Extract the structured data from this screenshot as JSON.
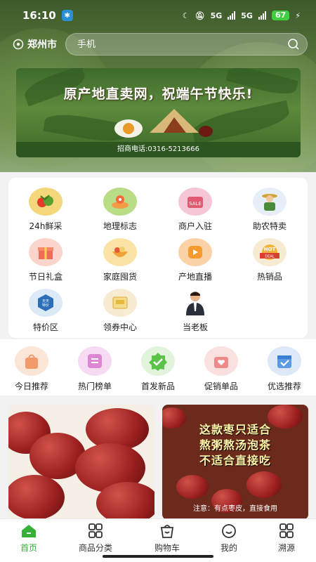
{
  "status": {
    "time": "16:10",
    "battery": "67",
    "network": "5G"
  },
  "topbar": {
    "location": "郑州市",
    "search_placeholder": "手机"
  },
  "banner": {
    "title": "原产地直卖网，祝端午节快乐!",
    "phone": "招商电话:0316-5213666"
  },
  "categories": [
    {
      "label": "24h鲜采",
      "icon": "vegetable-icon",
      "color": "#f3d77a"
    },
    {
      "label": "地理标志",
      "icon": "location-globe-icon",
      "color": "#b9dd87"
    },
    {
      "label": "商户入驻",
      "icon": "shop-sale-icon",
      "color": "#f5c6d6"
    },
    {
      "label": "助农特卖",
      "icon": "farmer-icon",
      "color": "#e6eef8"
    },
    {
      "label": "节日礼盒",
      "icon": "gift-box-icon",
      "color": "#fbd4cc"
    },
    {
      "label": "家庭囤货",
      "icon": "food-bowl-icon",
      "color": "#fbe3a6"
    },
    {
      "label": "产地直播",
      "icon": "live-video-icon",
      "color": "#fbd2a6"
    },
    {
      "label": "热销品",
      "icon": "hot-deal-icon",
      "color": "#f7ecd2"
    },
    {
      "label": "特价区",
      "icon": "special-price-icon",
      "color": "#dce9f7"
    },
    {
      "label": "领券中心",
      "icon": "coupon-icon",
      "color": "#f7ecd2"
    },
    {
      "label": "当老板",
      "icon": "businessman-icon",
      "color": "#ffffff"
    }
  ],
  "quick": [
    {
      "label": "今日推荐",
      "icon": "bag-icon",
      "color": "#f6b08a"
    },
    {
      "label": "热门榜单",
      "icon": "list-icon",
      "color": "#e9a7e2"
    },
    {
      "label": "首发新品",
      "icon": "badge-check-icon",
      "color": "#7fd36c"
    },
    {
      "label": "促销单品",
      "icon": "heart-gift-icon",
      "color": "#f3a1a1"
    },
    {
      "label": "优选推荐",
      "icon": "calendar-check-icon",
      "color": "#8ab8ee"
    }
  ],
  "products": {
    "right_title_1": "这款枣只适合",
    "right_title_2": "熬粥熬汤泡茶",
    "right_title_3": "不适合直接吃",
    "right_note": "注意：有点枣皮，直接食用"
  },
  "tabs": [
    {
      "label": "首页",
      "icon": "home-icon",
      "active": true
    },
    {
      "label": "商品分类",
      "icon": "grid-icon"
    },
    {
      "label": "购物车",
      "icon": "cart-icon"
    },
    {
      "label": "我的",
      "icon": "user-smile-icon"
    },
    {
      "label": "溯源",
      "icon": "trace-grid-icon"
    }
  ],
  "colors": {
    "accent": "#38b13a"
  }
}
